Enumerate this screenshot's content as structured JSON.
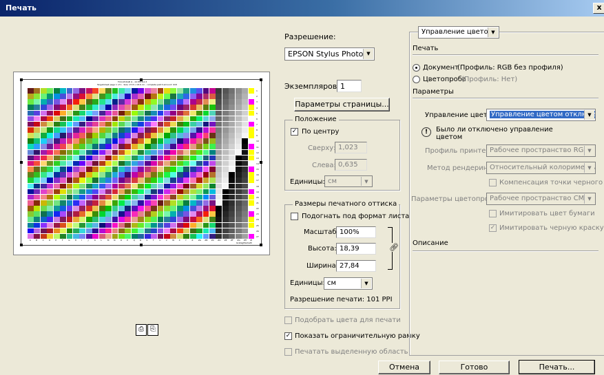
{
  "window": {
    "title": "Печать",
    "close": "x"
  },
  "resolution": {
    "label": "Разрешение:",
    "printer": "EPSON Stylus Photo..."
  },
  "copies": {
    "label": "Экземпляров:",
    "value": "1"
  },
  "page_setup_button": "Параметры страницы...",
  "position": {
    "title": "Положение",
    "center_label": "По центру",
    "center_checked": true,
    "top_label": "Сверху:",
    "top_value": "1,023",
    "left_label": "Слева:",
    "left_value": "0,635",
    "units_label": "Единицы:",
    "units_value": "см"
  },
  "print_size": {
    "title": "Размеры печатного оттиска",
    "fit_label": "Подогнать под формат листа",
    "scale_label": "Масштаб:",
    "scale_value": "100%",
    "height_label": "Высота:",
    "height_value": "18,39",
    "width_label": "Ширина:",
    "width_value": "27,84",
    "units_label": "Единицы:",
    "units_value": "см",
    "print_resolution": "Разрешение печати: 101 PPI"
  },
  "options": {
    "match_colors": "Подобрать цвета для печати",
    "show_bounding_box": "Показать ограничительную рамку",
    "print_selected": "Печатать выделенную область"
  },
  "right_panel": {
    "mode_select": "Управление цветом",
    "print_heading": "Печать",
    "document_label": "Документ",
    "document_profile": "(Профиль: RGB без профиля)",
    "proof_label": "Цветопроба",
    "proof_profile": "(Профиль: Нет)",
    "params_heading": "Параметры",
    "color_handling_label": "Управление цветом:",
    "color_handling_value": "Управление цветом отключено",
    "info_line1": "Было ли отключено управление",
    "info_line2": "цветом",
    "printer_profile_label": "Профиль принтера:",
    "printer_profile_value": "Рабочее пространство RGB - s...",
    "render_label": "Метод рендеринга:",
    "render_value": "Относительный колориметри...",
    "black_point_label": "Компенсация точки черного",
    "proof_setup_label": "Параметры цветопробы:",
    "proof_setup_value": "Рабочее пространство CMYK",
    "simulate_paper": "Имитировать цвет бумаги",
    "simulate_black": "Имитировать черную краску",
    "description_heading": "Описание"
  },
  "buttons": {
    "cancel": "Отмена",
    "done": "Готово",
    "print": "Печать..."
  },
  "preview": {
    "header": "TC9.18 RGB i1 - 22 PM 6.0.3",
    "subheader": "Targetsheet page 1 of 1 . Size: 27.8 x 18.6 cm - complete patch amount: 918",
    "column_letters": [
      "A",
      "B",
      "C",
      "D",
      "E",
      "F",
      "G",
      "H",
      "I",
      "J",
      "K",
      "L",
      "M",
      "N",
      "O",
      "P",
      "Q",
      "R",
      "S",
      "T",
      "U",
      "V",
      "W",
      "X",
      "Y",
      "Z",
      "ZA",
      "ZB",
      "ZC",
      "ZD",
      "ZE",
      "ZF",
      "ZG",
      "ZH",
      "ZI"
    ],
    "row_numbers": [
      "1",
      "2",
      "3",
      "4",
      "5",
      "6",
      "7",
      "8",
      "9",
      "10",
      "11",
      "12",
      "13",
      "14",
      "15",
      "16",
      "17",
      "18",
      "19",
      "20",
      "21",
      "22",
      "23",
      "24",
      "25",
      "26",
      "27"
    ],
    "footer_note": "GretagMacbeth"
  }
}
